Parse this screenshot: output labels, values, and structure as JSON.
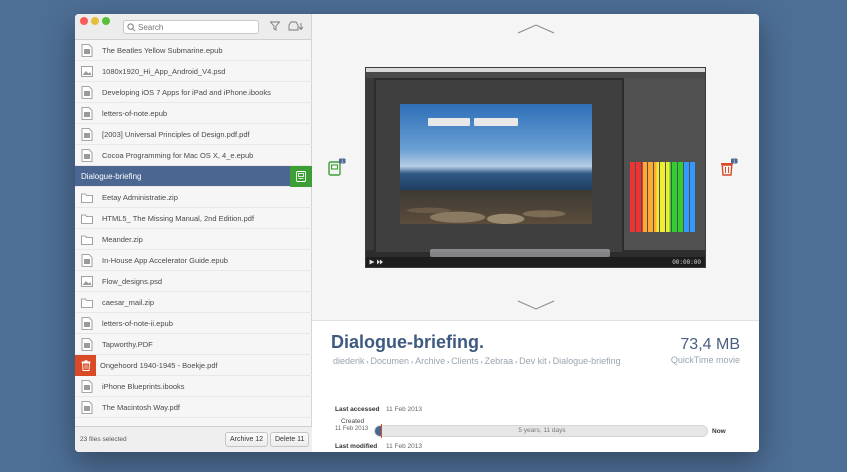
{
  "search": {
    "placeholder": "Search"
  },
  "files": [
    "The Beatles Yellow Submarine.epub",
    "1080x1920_Hi_App_Android_V4.psd",
    "Developing iOS 7 Apps for iPad and iPhone.ibooks",
    "letters-of-note.epub",
    "[2003] Universal Principles of Design.pdf.pdf",
    "Cocoa Programming for Mac OS X, 4_e.epub",
    "Dialogue-briefing",
    "Eetay Administratie.zip",
    "HTML5_ The Missing Manual, 2nd Edition.pdf",
    "Meander.zip",
    "In-House App Accelerator Guide.epub",
    "Flow_designs.psd",
    "caesar_mail.zip",
    "letters-of-note-ii.epub",
    "Tapworthy.PDF",
    "Ongehoord 1940-1945 - Boekje.pdf",
    "iPhone Blueprints.ibooks",
    "The Macintosh Way.pdf"
  ],
  "footer": {
    "selected": "23 files selected",
    "archive_label": "Archive 12",
    "delete_label": "Delete 11"
  },
  "preview": {
    "time": "00:00:00"
  },
  "details": {
    "title": "Dialogue-briefing",
    "title_dot": ".",
    "path": [
      "diederik",
      "Documen",
      "Archive",
      "Clients",
      "Zebraa",
      "Dev kit",
      "Dialogue-briefing"
    ],
    "size": "73,4 MB",
    "kind": "QuickTime movie",
    "last_accessed_label": "Last accessed",
    "last_accessed": "11 Feb 2013",
    "created_label": "Created",
    "created": "11 Feb 2013",
    "last_modified_label": "Last modified",
    "last_modified": "11 Feb 2013",
    "age": "5 years, 11 days",
    "now_label": "Now"
  },
  "colors": {
    "accent": "#4a6691",
    "archive": "#3d9e36",
    "delete": "#d94a27"
  }
}
